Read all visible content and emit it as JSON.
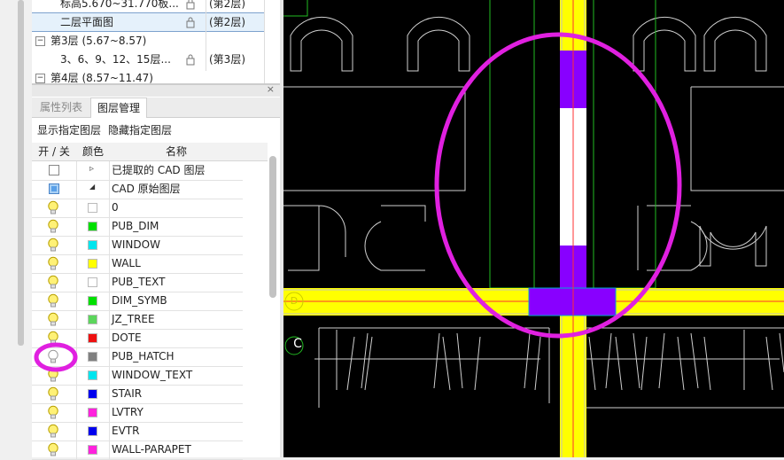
{
  "floor_tree": {
    "rows": [
      {
        "label": "标高5.670~31.770板...",
        "floor": "(第2层)",
        "locked": true,
        "selected": false
      },
      {
        "label": "二层平面图",
        "floor": "(第2层)",
        "locked": true,
        "selected": true
      },
      {
        "label": "第3层 (5.67~8.57)",
        "expander": "−",
        "group": true
      },
      {
        "label": "3、6、9、12、15层...",
        "floor": "(第3层)",
        "locked": true,
        "selected": false
      },
      {
        "label": "第4层 (8.57~11.47)",
        "expander": "−",
        "group": true
      }
    ]
  },
  "panel": {
    "close_glyph": "×",
    "tabs": [
      {
        "label": "属性列表",
        "active": false
      },
      {
        "label": "图层管理",
        "active": true
      }
    ],
    "toolbar": {
      "show_layer": "显示指定图层",
      "hide_layer": "隐藏指定图层"
    },
    "columns": {
      "toggle": "开 / 关",
      "color": "颜色",
      "name": "名称"
    },
    "groups": [
      {
        "label": "已提取的 CAD 图层",
        "expander": "▹",
        "checked": false
      },
      {
        "label": "CAD 原始图层",
        "expander": "◢",
        "checked": true
      }
    ],
    "layers": [
      {
        "name": "0",
        "color": "#ffffff",
        "on": true
      },
      {
        "name": "PUB_DIM",
        "color": "#00e000",
        "on": true
      },
      {
        "name": "WINDOW",
        "color": "#00e5ee",
        "on": true
      },
      {
        "name": "WALL",
        "color": "#ffff00",
        "on": true
      },
      {
        "name": "PUB_TEXT",
        "color": "#ffffff",
        "on": true
      },
      {
        "name": "DIM_SYMB",
        "color": "#00e000",
        "on": true
      },
      {
        "name": "JZ_TREE",
        "color": "#5cd65c",
        "on": true
      },
      {
        "name": "DOTE",
        "color": "#ee1111",
        "on": true
      },
      {
        "name": "PUB_HATCH",
        "color": "#808080",
        "on": false
      },
      {
        "name": "WINDOW_TEXT",
        "color": "#00e5ee",
        "on": true
      },
      {
        "name": "STAIR",
        "color": "#0000ee",
        "on": true
      },
      {
        "name": "LVTRY",
        "color": "#ff22dd",
        "on": true
      },
      {
        "name": "EVTR",
        "color": "#0000ee",
        "on": true
      },
      {
        "name": "WALL-PARAPET",
        "color": "#ff22dd",
        "on": true
      }
    ]
  },
  "cad": {
    "axis_label": "C",
    "axis_label_left": "D",
    "highlight_color": "#e020e0",
    "column_color": "#8800ff",
    "wall_color": "#ffff00"
  }
}
